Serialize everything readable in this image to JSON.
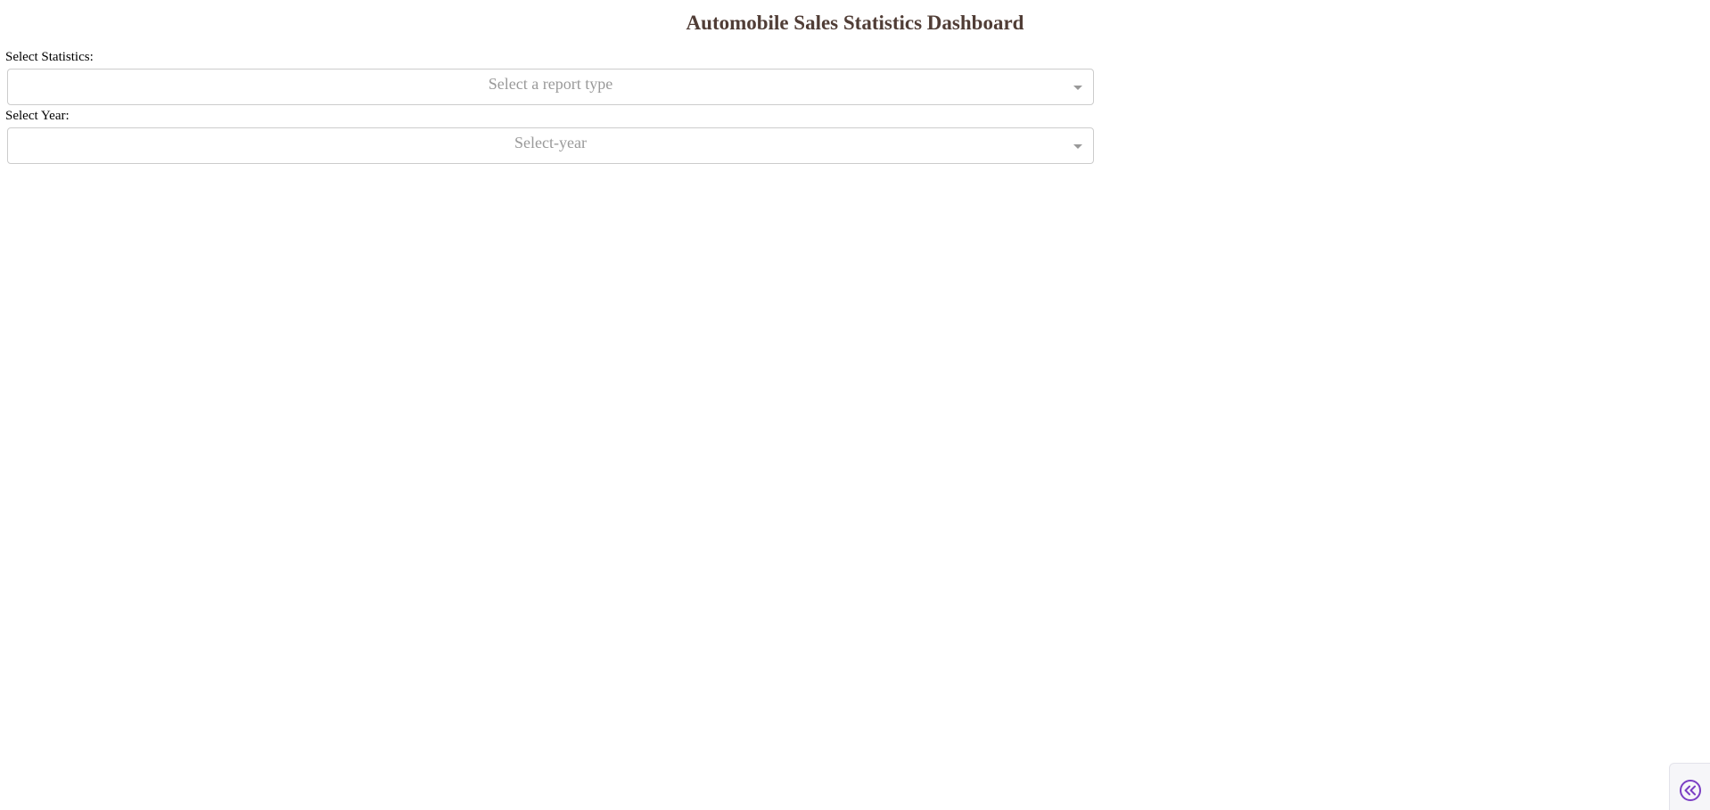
{
  "header": {
    "title": "Automobile Sales Statistics Dashboard",
    "title_color": "#503D36"
  },
  "statistics_dropdown": {
    "label": "Select Statistics:",
    "placeholder": "Select a report type"
  },
  "year_dropdown": {
    "label": "Select Year:",
    "placeholder": "Select-year"
  },
  "debug_toggle": {
    "icon": "double-chevron-left-icon",
    "accent_color": "#7B3FC4"
  }
}
